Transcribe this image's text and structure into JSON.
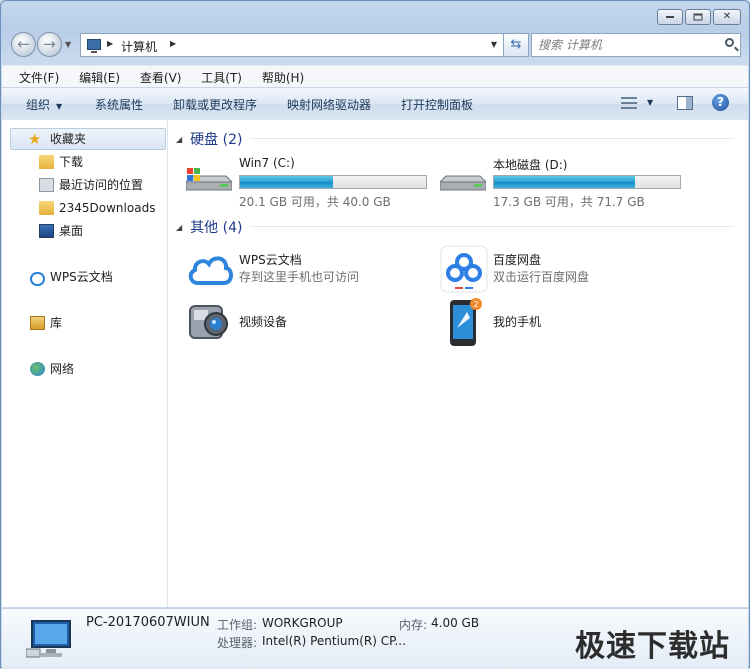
{
  "navigation": {
    "breadcrumb": "计算机",
    "search_placeholder": "搜索 计算机"
  },
  "menu": [
    "文件(F)",
    "编辑(E)",
    "查看(V)",
    "工具(T)",
    "帮助(H)"
  ],
  "toolbar": {
    "organize": "组织",
    "system_properties": "系统属性",
    "uninstall": "卸载或更改程序",
    "map_drive": "映射网络驱动器",
    "control_panel": "打开控制面板"
  },
  "sidebar": {
    "favorites": "收藏夹",
    "downloads": "下载",
    "recent": "最近访问的位置",
    "folder_2345": "2345Downloads",
    "desktop": "桌面",
    "wps": "WPS云文档",
    "libraries": "库",
    "network": "网络"
  },
  "sections": {
    "hard_disks": "硬盘 (2)",
    "other": "其他 (4)"
  },
  "drives": [
    {
      "name": "Win7 (C:)",
      "info": "20.1 GB 可用，共 40.0 GB",
      "used_fraction": 0.5
    },
    {
      "name": "本地磁盘 (D:)",
      "info": "17.3 GB 可用，共 71.7 GB",
      "used_fraction": 0.76
    }
  ],
  "other_items": {
    "wps_name": "WPS云文档",
    "wps_desc": "存到这里手机也可访问",
    "baidu_name": "百度网盘",
    "baidu_desc": "双击运行百度网盘",
    "camera_name": "视频设备",
    "phone_name": "我的手机",
    "phone_badge": "2"
  },
  "details": {
    "computer_name": "PC-20170607WIUN",
    "workgroup_label": "工作组:",
    "workgroup_value": "WORKGROUP",
    "memory_label": "内存:",
    "memory_value": "4.00 GB",
    "processor_label": "处理器:",
    "processor_value": "Intel(R) Pentium(R) CP..."
  },
  "watermark": "极速下载站",
  "colors": {
    "accent": "#1e3b8a",
    "drive_fill": "#26a0d6"
  }
}
